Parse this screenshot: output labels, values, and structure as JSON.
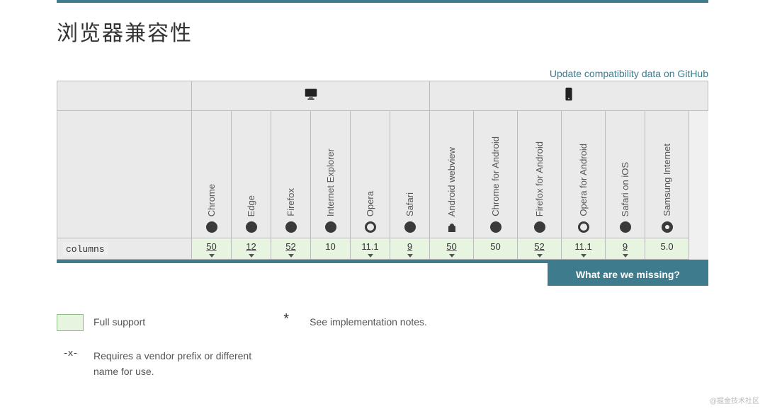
{
  "section_title": "浏览器兼容性",
  "update_link": "Update compatibility data on GitHub",
  "platforms": {
    "desktop": {
      "icon": "desktop-icon",
      "colspan": 6
    },
    "mobile": {
      "icon": "mobile-icon",
      "colspan": 7
    }
  },
  "browsers": [
    {
      "name": "Chrome",
      "icon": "chrome-icon"
    },
    {
      "name": "Edge",
      "icon": "edge-icon"
    },
    {
      "name": "Firefox",
      "icon": "firefox-icon"
    },
    {
      "name": "Internet Explorer",
      "icon": "ie-icon"
    },
    {
      "name": "Opera",
      "icon": "opera-icon"
    },
    {
      "name": "Safari",
      "icon": "safari-icon"
    },
    {
      "name": "Android webview",
      "icon": "android-icon"
    },
    {
      "name": "Chrome for Android",
      "icon": "chrome-icon"
    },
    {
      "name": "Firefox for Android",
      "icon": "firefox-icon"
    },
    {
      "name": "Opera for Android",
      "icon": "opera-icon"
    },
    {
      "name": "Safari on iOS",
      "icon": "safari-icon"
    },
    {
      "name": "Samsung Internet",
      "icon": "samsung-icon"
    }
  ],
  "feature": {
    "name": "columns",
    "support": [
      {
        "value": "50",
        "expandable": true,
        "underline": true
      },
      {
        "value": "12",
        "expandable": true,
        "underline": true
      },
      {
        "value": "52",
        "expandable": true,
        "underline": true
      },
      {
        "value": "10",
        "expandable": false,
        "underline": false
      },
      {
        "value": "11.1",
        "expandable": true,
        "underline": false
      },
      {
        "value": "9",
        "expandable": true,
        "underline": true
      },
      {
        "value": "50",
        "expandable": true,
        "underline": true
      },
      {
        "value": "50",
        "expandable": false,
        "underline": false
      },
      {
        "value": "52",
        "expandable": true,
        "underline": true
      },
      {
        "value": "11.1",
        "expandable": true,
        "underline": false
      },
      {
        "value": "9",
        "expandable": true,
        "underline": true
      },
      {
        "value": "5.0",
        "expandable": false,
        "underline": false
      }
    ]
  },
  "missing_label": "What are we missing?",
  "legend": {
    "full_support": "Full support",
    "notes": "See implementation notes.",
    "prefix": "Requires a vendor prefix or different name for use."
  },
  "colors": {
    "accent": "#3e7b8c",
    "support_bg": "#e6f4e0"
  },
  "watermark": "@掘金技术社区"
}
